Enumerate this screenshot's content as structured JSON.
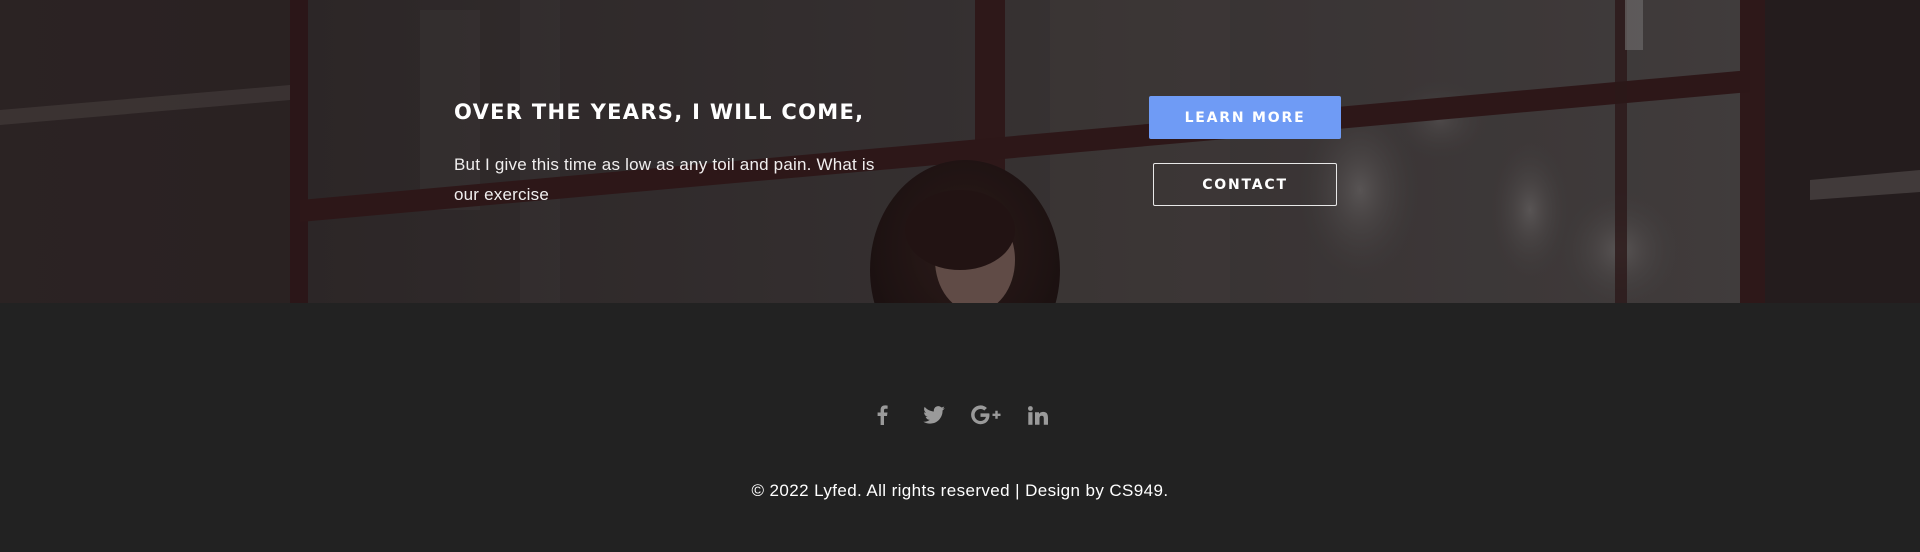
{
  "cta": {
    "title": "OVER THE YEARS, I WILL COME,",
    "text": "But I give this time as low as any toil and pain. What is our exercise",
    "learn_more_label": "LEARN MORE",
    "contact_label": "CONTACT",
    "accent_color": "#6f9bf5"
  },
  "footer": {
    "social_icons": [
      "facebook-icon",
      "twitter-icon",
      "google-plus-icon",
      "linkedin-icon"
    ],
    "copyright": "© 2022 Lyfed. All rights reserved | Design by CS949.",
    "background_color": "#222222"
  }
}
